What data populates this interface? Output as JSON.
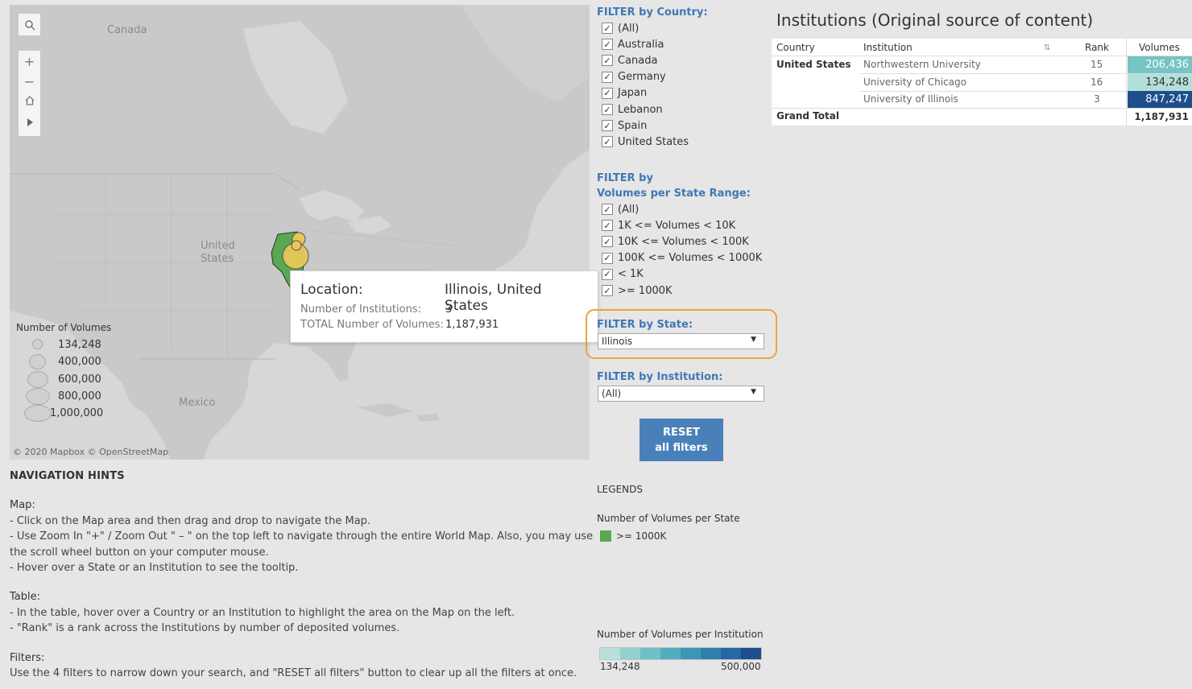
{
  "map": {
    "labels": {
      "canada": "Canada",
      "united_states": "United\nStates",
      "mexico": "Mexico"
    },
    "attribution": "© 2020 Mapbox  © OpenStreetMap",
    "controls": [
      "search-icon",
      "plus-icon",
      "minus-icon",
      "home-icon",
      "play-icon"
    ],
    "state_fill": "#5aa852",
    "bubble_fill": "#e8c65a",
    "size_legend": {
      "title": "Number of Volumes",
      "items": [
        "134,248",
        "400,000",
        "600,000",
        "800,000",
        "1,000,000"
      ]
    },
    "tooltip": {
      "location_label": "Location:",
      "location_value": "Illinois, United States",
      "institutions_label": "Number of Institutions:",
      "institutions_value": "3",
      "volumes_label": "TOTAL Number of Volumes:",
      "volumes_value": "1,187,931"
    }
  },
  "filters": {
    "country": {
      "title": "FILTER by Country:",
      "items": [
        "(All)",
        "Australia",
        "Canada",
        "Germany",
        "Japan",
        "Lebanon",
        "Spain",
        "United States"
      ]
    },
    "range": {
      "title_line1": "FILTER by",
      "title_line2": "Volumes per State Range:",
      "items": [
        "(All)",
        "1K <= Volumes < 10K",
        "10K <= Volumes < 100K",
        "100K <= Volumes < 1000K",
        "< 1K",
        ">= 1000K"
      ]
    },
    "state": {
      "title": "FILTER by State:",
      "value": "Illinois"
    },
    "institution": {
      "title": "FILTER by Institution:",
      "value": "(All)"
    },
    "reset_line1": "RESET",
    "reset_line2": "all filters",
    "checkmark": "✓"
  },
  "legends": {
    "title": "LEGENDS",
    "state_title": "Number of Volumes per State",
    "state_item": ">= 1000K",
    "institution_title": "Number of Volumes per Institution",
    "gradient_min": "134,248",
    "gradient_max": "500,000",
    "gradient_colors": [
      "#b7e0dc",
      "#93d1d0",
      "#6fc0c6",
      "#4eaec0",
      "#3a97b7",
      "#2f7fae",
      "#2668a3",
      "#1e4f8c"
    ]
  },
  "table": {
    "title": "Institutions (Original source of content)",
    "headers": {
      "country": "Country",
      "institution": "Institution",
      "sort_icon": "sort-icon",
      "rank": "Rank",
      "volumes": "Volumes"
    },
    "country": "United States",
    "rows": [
      {
        "institution": "Northwestern University",
        "rank": "15",
        "volumes": "206,436",
        "color": "#76c4c4"
      },
      {
        "institution": "University of Chicago",
        "rank": "16",
        "volumes": "134,248",
        "color": "#b3dfd9"
      },
      {
        "institution": "University of Illinois",
        "rank": "3",
        "volumes": "847,247",
        "color": "#1f4e8c"
      }
    ],
    "grand_total_label": "Grand Total",
    "grand_total_value": "1,187,931"
  },
  "hints": {
    "title": "NAVIGATION HINTS",
    "map_title": "Map:",
    "map_lines": [
      "- Click on the Map area and then drag and drop to navigate the Map.",
      "- Use Zoom In \"+\" / Zoom Out \" – \" on the top left to navigate through the entire World Map. Also, you may use the scroll wheel button on your computer mouse.",
      "- Hover over a State or an Institution to see the tooltip."
    ],
    "table_title": "Table:",
    "table_lines": [
      "- In the table, hover over a Country or an Institution to highlight the area on the Map on the left.",
      "- \"Rank\" is a rank across the Institutions by number of deposited volumes."
    ],
    "filters_title": "Filters:",
    "filters_line": "Use the 4 filters to narrow down your search, and \"RESET all filters\" button to clear up all the filters at once."
  }
}
